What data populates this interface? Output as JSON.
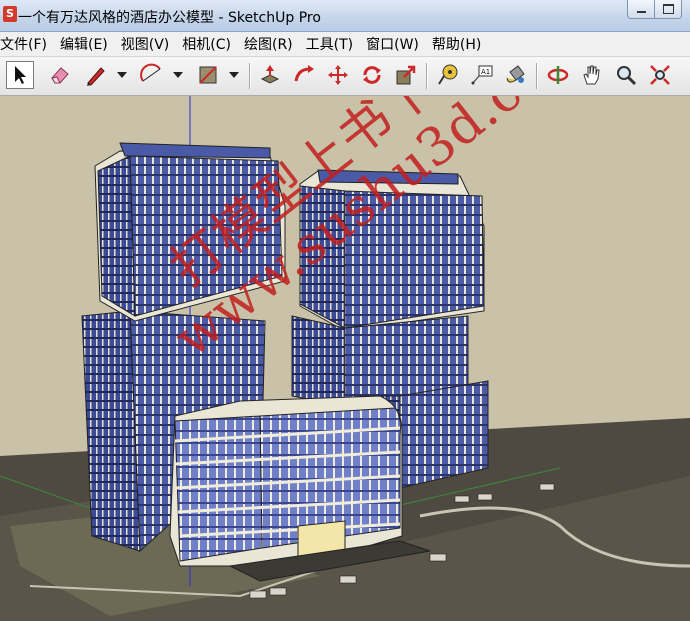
{
  "window": {
    "title": "一个有万达风格的酒店办公模型 - SketchUp Pro",
    "app_icon_glyph": "S"
  },
  "menu": {
    "items": [
      {
        "label": "文件(F)"
      },
      {
        "label": "编辑(E)"
      },
      {
        "label": "视图(V)"
      },
      {
        "label": "相机(C)"
      },
      {
        "label": "绘图(R)"
      },
      {
        "label": "工具(T)"
      },
      {
        "label": "窗口(W)"
      },
      {
        "label": "帮助(H)"
      }
    ]
  },
  "toolbar": {
    "tools": [
      {
        "icon": "select-arrow-icon",
        "active": true
      },
      {
        "icon": "eraser-icon"
      },
      {
        "icon": "pencil-line-icon",
        "dropdown": true
      },
      {
        "icon": "arc-icon",
        "dropdown": true
      },
      {
        "icon": "rectangle-icon",
        "dropdown": true
      },
      {
        "icon": "push-pull-icon"
      },
      {
        "icon": "follow-me-icon"
      },
      {
        "icon": "move-icon"
      },
      {
        "icon": "rotate-icon"
      },
      {
        "icon": "scale-icon"
      },
      {
        "icon": "tape-measure-icon"
      },
      {
        "icon": "text-label-icon",
        "label": "A1"
      },
      {
        "icon": "paint-bucket-icon"
      },
      {
        "icon": "orbit-icon"
      },
      {
        "icon": "pan-hand-icon"
      },
      {
        "icon": "zoom-icon"
      },
      {
        "icon": "zoom-extents-icon"
      }
    ]
  },
  "viewport": {
    "watermark_line1": "打模型上书下",
    "watermark_line2": "www.sushu3d.com",
    "colors": {
      "sky": "#c9c2a8",
      "ground": "#4f4a41",
      "glass": "#4a5aa6",
      "frame": "#e9e6d6",
      "watermark": "#c21f1f"
    }
  }
}
